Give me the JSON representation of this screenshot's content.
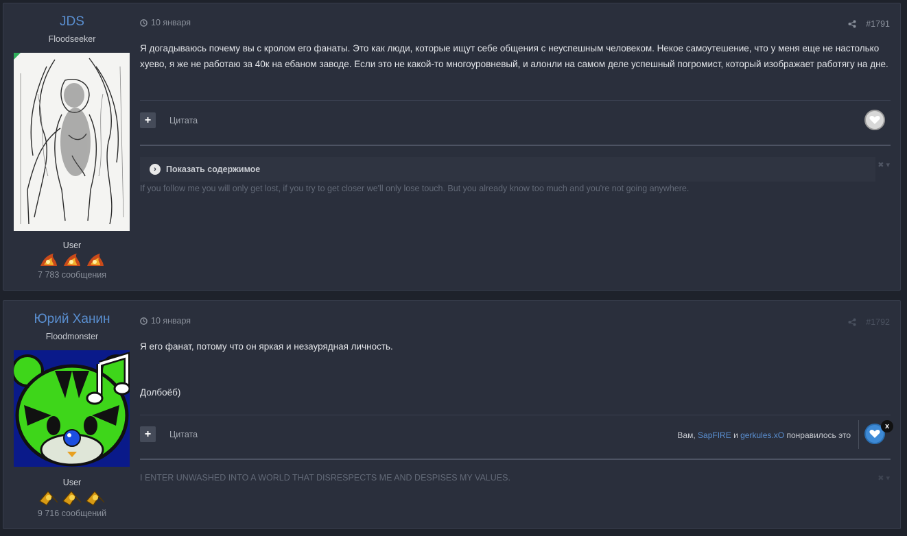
{
  "posts": [
    {
      "author": {
        "name": "JDS",
        "title": "Floodseeker",
        "group": "User",
        "post_count": "7 783 сообщения",
        "avatar": "sketch-creature-avatar",
        "badges": [
          "flame-badge-icon",
          "flame-badge-icon",
          "flame-badge-icon"
        ]
      },
      "date": "10 января",
      "number": "#1791",
      "content": [
        "Я догадываюсь почему вы с кролом его фанаты. Это как люди, которые ищут себе общения с неуспешным человеком. Некое самоутешение, что у меня еще не настолько хуево, я же не работаю за 40к на ебаном заводе. Если это не какой-то многоуровневый, и алонли на самом деле успешный погромист, который изображает работягу на дне."
      ],
      "quote_label": "Цитата",
      "spoiler_label": "Показать содержимое",
      "signature": "If you follow me you will only get lost, if you try to get closer we'll only lose touch. But you already know too much and you're not going anywhere."
    },
    {
      "author": {
        "name": "Юрий Ханин",
        "title": "Floodmonster",
        "group": "User",
        "post_count": "9 716 сообщений",
        "avatar": "green-cat-music-avatar",
        "badges": [
          "gold-star-badge-icon",
          "gold-star-badge-icon",
          "gold-star-badge-icon"
        ]
      },
      "date": "10 января",
      "number": "#1792",
      "content": [
        "Я его фанат, потому что он яркая и незаурядная личность.",
        "Долбоёб)"
      ],
      "quote_label": "Цитата",
      "reactions": {
        "prefix": "Вам,",
        "user1": "SapFIRE",
        "conj": "и",
        "user2": "gerkules.xO",
        "suffix": "понравилось это"
      },
      "remove_label": "x",
      "signature": "I ENTER UNWASHED INTO A WORLD THAT DISRESPECTS ME AND DESPISES MY VALUES."
    }
  ],
  "colors": {
    "accent": "#5a8fd1",
    "background": "#1e222b",
    "panel": "#2a2f3c"
  }
}
